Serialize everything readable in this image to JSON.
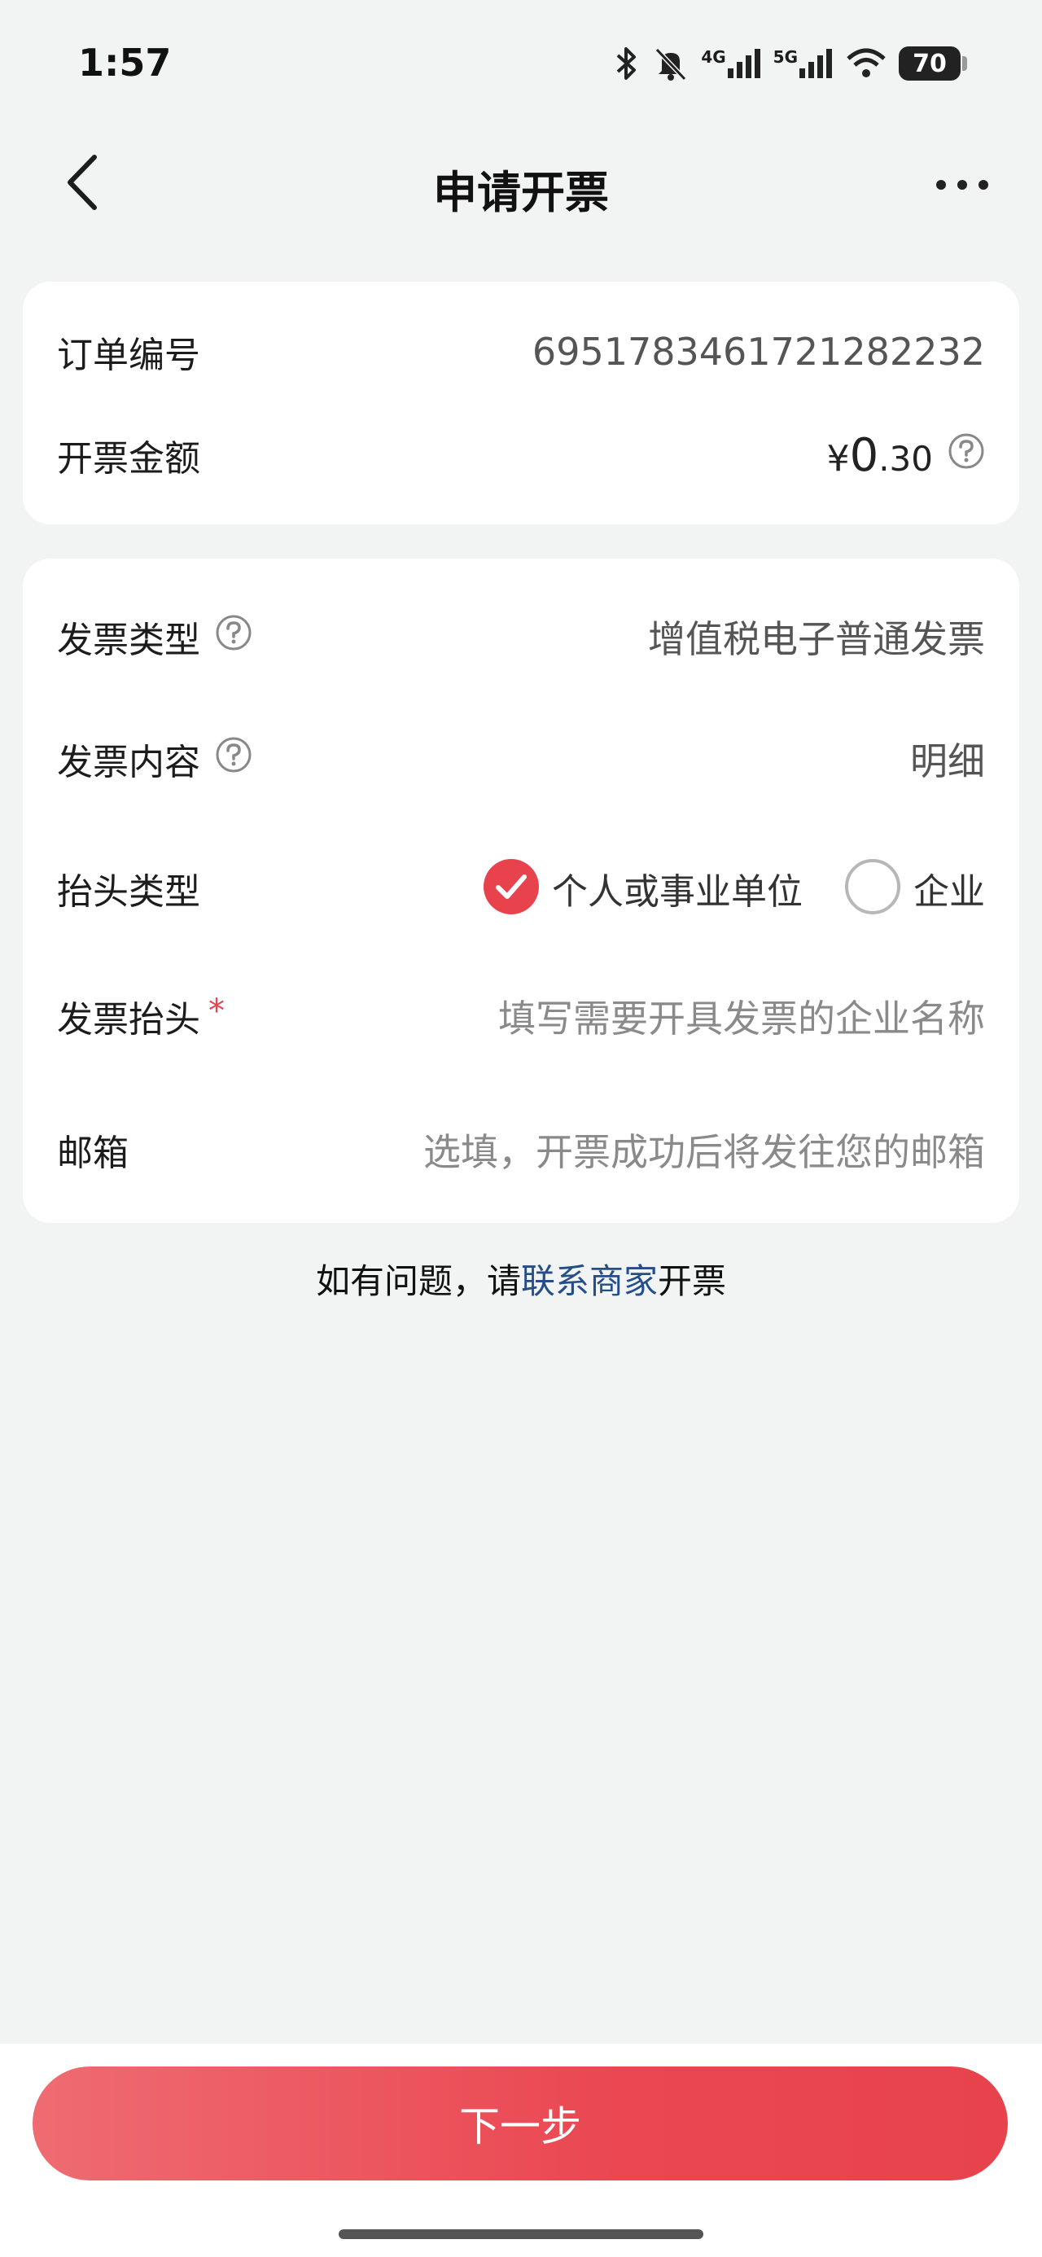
{
  "status_bar": {
    "time": "1:57",
    "network_4g": "4G",
    "network_5g": "5G",
    "battery": "70"
  },
  "nav": {
    "title": "申请开票"
  },
  "order_card": {
    "order_label": "订单编号",
    "order_number": "6951783461721282232",
    "amount_label": "开票金额",
    "currency": "¥",
    "amount_int": "0",
    "amount_dec": ".30"
  },
  "invoice_card": {
    "type_label": "发票类型",
    "type_value": "增值税电子普通发票",
    "content_label": "发票内容",
    "content_value": "明细",
    "header_type_label": "抬头类型",
    "options": [
      {
        "label": "个人或事业单位",
        "selected": true
      },
      {
        "label": "企业",
        "selected": false
      }
    ],
    "header_label": "发票抬头",
    "required_mark": "*",
    "header_placeholder": "填写需要开具发票的企业名称",
    "email_label": "邮箱",
    "email_placeholder": "选填，开票成功后将发往您的邮箱"
  },
  "footer_note": {
    "prefix": "如有问题，请",
    "link": "联系商家",
    "suffix": "开票"
  },
  "actions": {
    "next_label": "下一步"
  },
  "colors": {
    "accent": "#e8434d",
    "link": "#244d8a",
    "background": "#f2f3f3"
  }
}
